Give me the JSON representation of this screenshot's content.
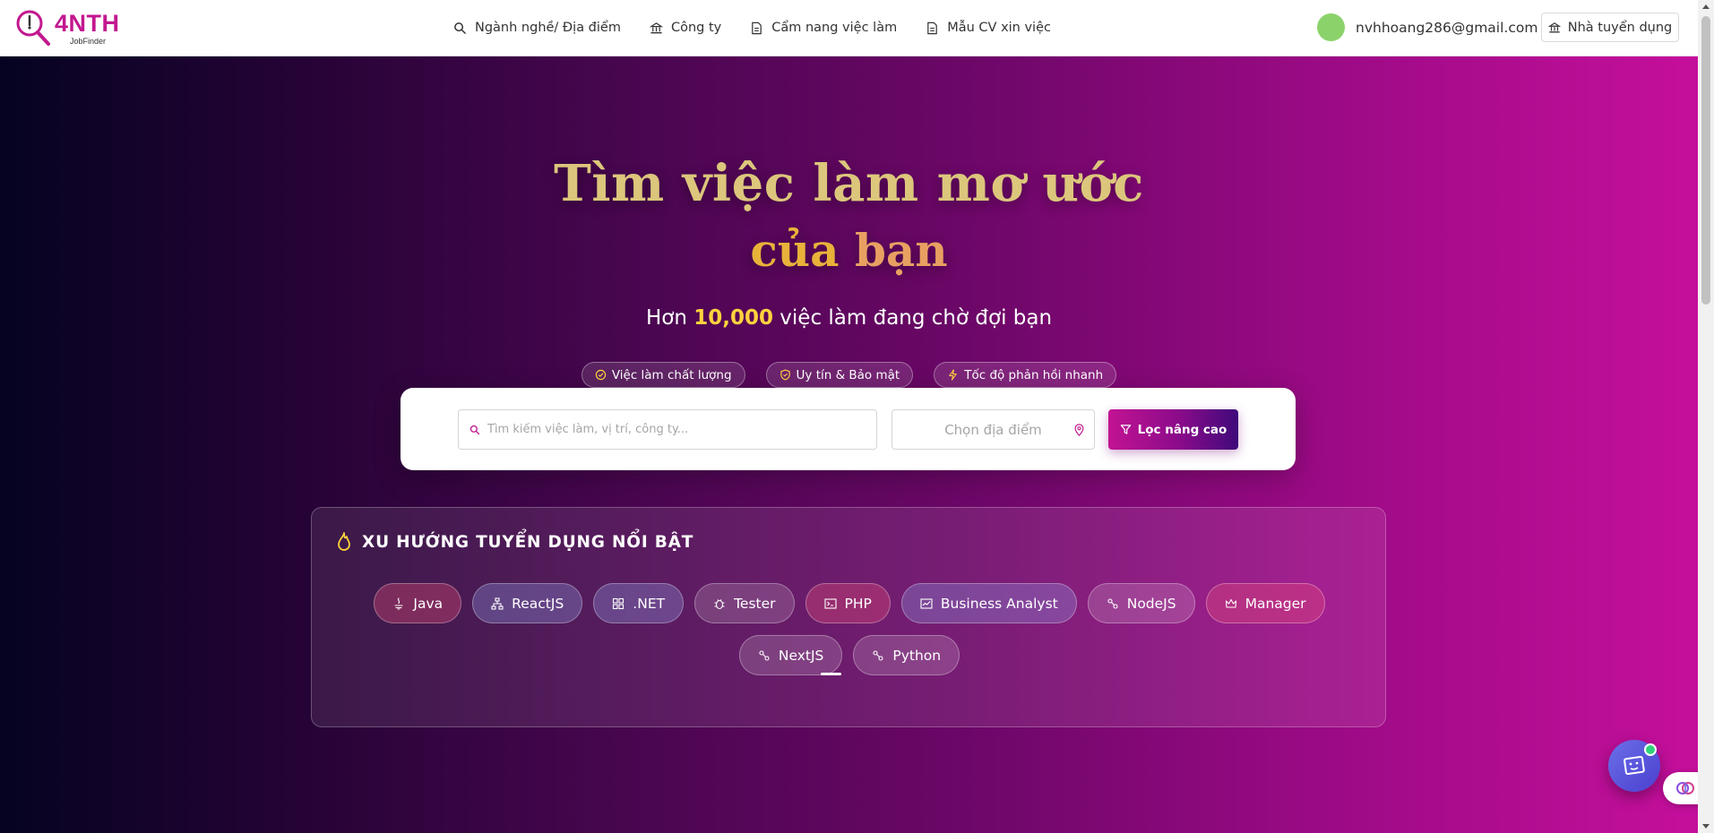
{
  "header": {
    "logo_text": "4NTH",
    "logo_sub": "JobFinder",
    "nav": [
      {
        "label": "Ngành nghề/ Địa điểm",
        "icon": "search-icon"
      },
      {
        "label": "Công ty",
        "icon": "building-icon"
      },
      {
        "label": "Cẩm nang việc làm",
        "icon": "document-icon"
      },
      {
        "label": "Mẫu CV xin việc",
        "icon": "document-icon"
      }
    ],
    "user_email": "nvhhoang286@gmail.com",
    "employer_button": "Nhà tuyển dụng"
  },
  "hero": {
    "title_line1": "Tìm việc làm mơ ước",
    "title_line2_a": "của ",
    "title_line2_b": "bạn",
    "subtitle_prefix": "Hơn ",
    "subtitle_number": "10,000",
    "subtitle_suffix": " việc làm đang chờ đợi bạn",
    "badges": [
      {
        "label": "Việc làm chất lượng",
        "icon": "check-circle-icon"
      },
      {
        "label": "Uy tín & Bảo mật",
        "icon": "shield-icon"
      },
      {
        "label": "Tốc độ phản hồi nhanh",
        "icon": "lightning-icon"
      }
    ]
  },
  "search": {
    "placeholder": "Tìm kiếm việc làm, vị trí, công ty...",
    "location_placeholder": "Chọn địa điểm",
    "filter_button": "Lọc nâng cao"
  },
  "trending": {
    "title": "XU HƯỚNG TUYỂN DỤNG NỔI BẬT",
    "tags": [
      {
        "label": "Java",
        "icon": "java-icon"
      },
      {
        "label": "ReactJS",
        "icon": "sitemap-icon"
      },
      {
        "label": ".NET",
        "icon": "windows-icon"
      },
      {
        "label": "Tester",
        "icon": "bug-icon"
      },
      {
        "label": "PHP",
        "icon": "terminal-icon"
      },
      {
        "label": "Business Analyst",
        "icon": "chart-icon"
      },
      {
        "label": "NodeJS",
        "icon": "node-icon"
      },
      {
        "label": "Manager",
        "icon": "crown-icon"
      },
      {
        "label": "NextJS",
        "icon": "node-icon"
      },
      {
        "label": "Python",
        "icon": "node-icon"
      }
    ]
  },
  "colors": {
    "brand": "#c2188f",
    "accent_yellow": "#ffd23d",
    "title_gold": "#dcc67c"
  }
}
